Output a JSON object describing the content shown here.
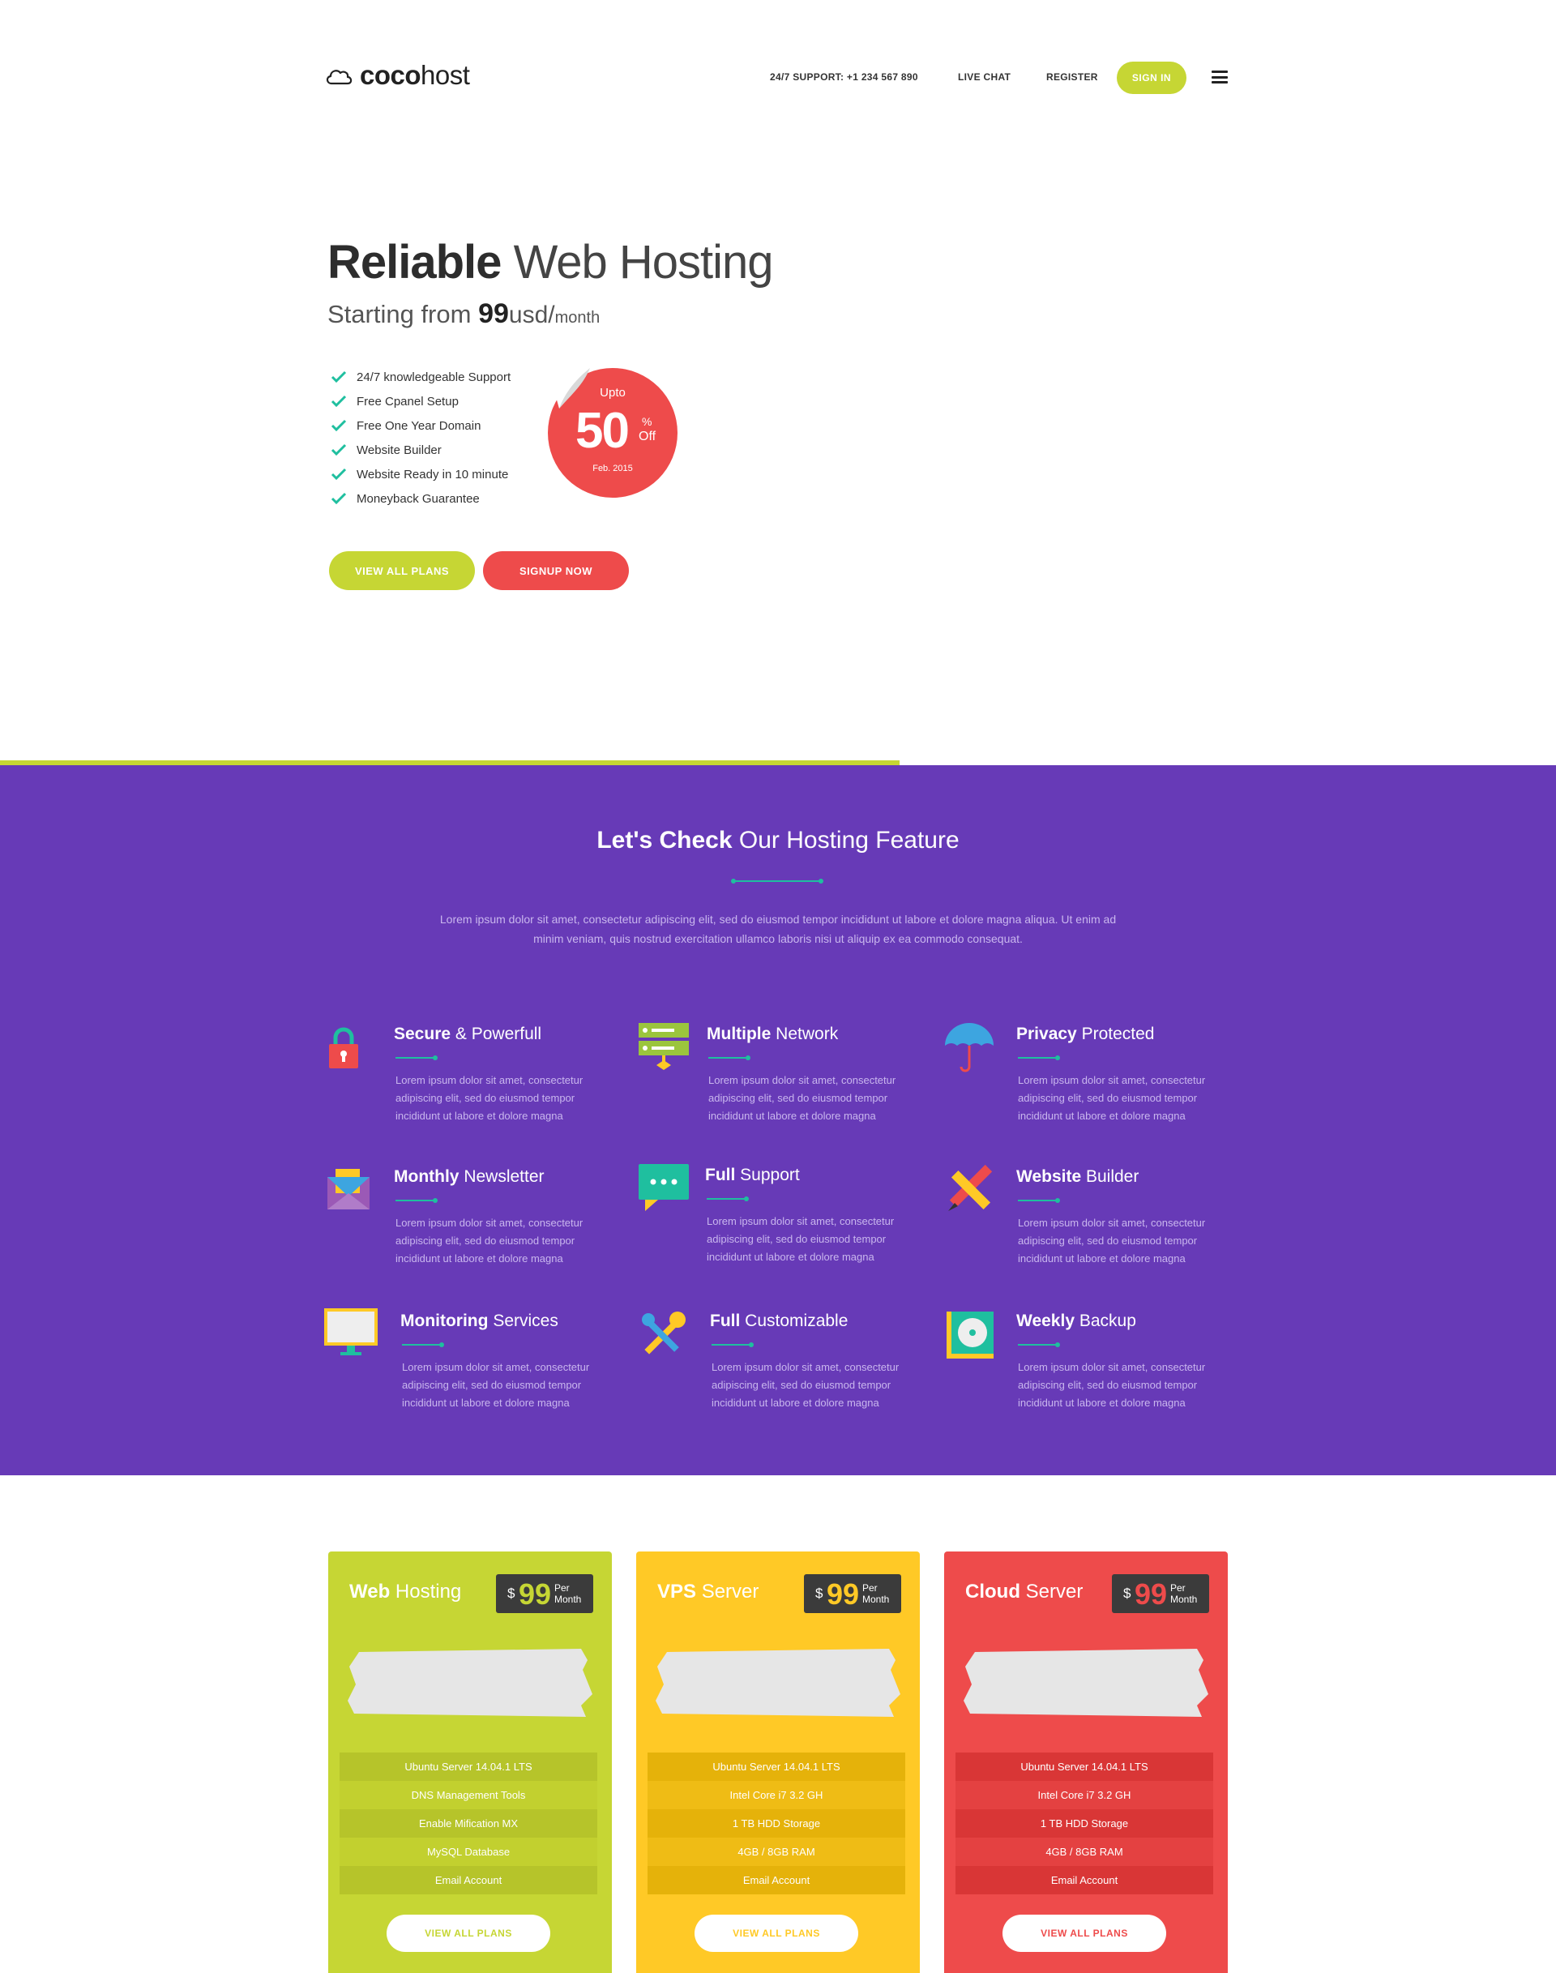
{
  "header": {
    "logo_bold": "coco",
    "logo_light": "host",
    "support": "24/7 SUPPORT: +1 234 567 890",
    "live_chat": "LIVE CHAT",
    "register": "REGISTER",
    "sign_in": "SIGN IN",
    "menu_icon": "hamburger-menu-icon"
  },
  "hero": {
    "title_bold": "Reliable",
    "title_light": "Web Hosting",
    "subtitle_prefix": "Starting from ",
    "price": "99",
    "currency": "usd/",
    "period": "month",
    "features": [
      "24/7 knowledgeable Support",
      "Free Cpanel Setup",
      "Free One Year Domain",
      "Website Builder",
      "Website Ready in 10 minute",
      "Moneyback Guarantee"
    ],
    "badge": {
      "upto": "Upto",
      "percent": "50",
      "pct_sign": "%",
      "off": "Off",
      "date": "Feb. 2015"
    },
    "view_all_plans": "VIEW ALL PLANS",
    "signup_now": "SIGNUP NOW"
  },
  "features_section": {
    "title_bold": "Let's Check",
    "title_light": "Our Hosting Feature",
    "description": "Lorem ipsum dolor sit amet, consectetur adipiscing elit, sed do eiusmod tempor incididunt ut labore et dolore magna aliqua. Ut enim ad minim veniam, quis nostrud exercitation ullamco laboris nisi ut aliquip ex ea commodo consequat.",
    "items": [
      {
        "bold": "Secure",
        "light": "& Powerfull",
        "icon": "padlock-icon",
        "desc": "Lorem ipsum dolor sit amet, consectetur adipiscing elit, sed do eiusmod tempor incididunt ut labore et dolore magna"
      },
      {
        "bold": "Multiple",
        "light": "Network",
        "icon": "server-network-icon",
        "desc": "Lorem ipsum dolor sit amet, consectetur adipiscing elit, sed do eiusmod tempor incididunt ut labore et dolore magna"
      },
      {
        "bold": "Privacy",
        "light": "Protected",
        "icon": "umbrella-icon",
        "desc": "Lorem ipsum dolor sit amet, consectetur adipiscing elit, sed do eiusmod tempor incididunt ut labore et dolore magna"
      },
      {
        "bold": "Monthly",
        "light": "Newsletter",
        "icon": "envelope-icon",
        "desc": "Lorem ipsum dolor sit amet, consectetur adipiscing elit, sed do eiusmod tempor incididunt ut labore et dolore magna"
      },
      {
        "bold": "Full",
        "light": "Support",
        "icon": "chat-bubble-icon",
        "desc": "Lorem ipsum dolor sit amet, consectetur adipiscing elit, sed do eiusmod tempor incididunt ut labore et dolore magna"
      },
      {
        "bold": "Website",
        "light": "Builder",
        "icon": "pencil-ruler-icon",
        "desc": "Lorem ipsum dolor sit amet, consectetur adipiscing elit, sed do eiusmod tempor incididunt ut labore et dolore magna"
      },
      {
        "bold": "Monitoring",
        "light": "Services",
        "icon": "monitor-icon",
        "desc": "Lorem ipsum dolor sit amet, consectetur adipiscing elit, sed do eiusmod tempor incididunt ut labore et dolore magna"
      },
      {
        "bold": "Full",
        "light": "Customizable",
        "icon": "wrench-screwdriver-icon",
        "desc": "Lorem ipsum dolor sit amet, consectetur adipiscing elit, sed do eiusmod tempor incididunt ut labore et dolore magna"
      },
      {
        "bold": "Weekly",
        "light": "Backup",
        "icon": "disk-backup-icon",
        "desc": "Lorem ipsum dolor sit amet, consectetur adipiscing elit, sed do eiusmod tempor incididunt ut labore et dolore magna"
      }
    ]
  },
  "pricing": [
    {
      "bold": "Web",
      "light": "Hosting",
      "currency": "$",
      "price": "99",
      "per": "Per",
      "period": "Month",
      "accent": "#c6d634",
      "specs": [
        "Ubuntu Server 14.04.1 LTS",
        "DNS Management Tools",
        "Enable Mification MX",
        "MySQL Database",
        "Email Account"
      ],
      "button": "VIEW ALL PLANS"
    },
    {
      "bold": "VPS",
      "light": "Server",
      "currency": "$",
      "price": "99",
      "per": "Per",
      "period": "Month",
      "accent": "#ffc926",
      "specs": [
        "Ubuntu Server 14.04.1 LTS",
        "Intel Core i7 3.2 GH",
        "1 TB HDD Storage",
        "4GB / 8GB RAM",
        "Email Account"
      ],
      "button": "VIEW ALL PLANS"
    },
    {
      "bold": "Cloud",
      "light": "Server",
      "currency": "$",
      "price": "99",
      "per": "Per",
      "period": "Month",
      "accent": "#ee4b4b",
      "specs": [
        "Ubuntu Server 14.04.1 LTS",
        "Intel Core i7 3.2 GH",
        "1 TB HDD Storage",
        "4GB / 8GB RAM",
        "Email Account"
      ],
      "button": "VIEW ALL PLANS"
    }
  ],
  "colors": {
    "green": "#c6d634",
    "yellow": "#ffc926",
    "red": "#ee4b4b",
    "purple": "#673ab7",
    "teal": "#1fbf9f"
  }
}
